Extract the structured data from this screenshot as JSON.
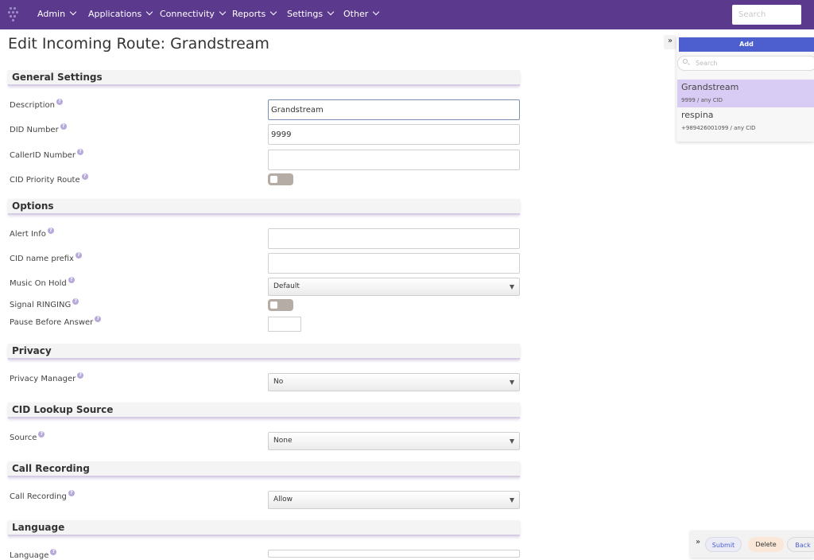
{
  "nav": {
    "items": [
      {
        "label": "Admin"
      },
      {
        "label": "Applications"
      },
      {
        "label": "Connectivity"
      },
      {
        "label": "Reports"
      },
      {
        "label": "Settings"
      },
      {
        "label": "Other"
      }
    ],
    "search_placeholder": "Search"
  },
  "page": {
    "title": "Edit Incoming Route: Grandstream"
  },
  "sections": {
    "general": {
      "title": "General Settings",
      "description_label": "Description",
      "description_value": "Grandstream",
      "did_label": "DID Number",
      "did_value": "9999",
      "callerid_label": "CallerID Number",
      "callerid_value": "",
      "cid_priority_label": "CID Priority Route",
      "cid_priority_on": false
    },
    "options": {
      "title": "Options",
      "alert_info_label": "Alert Info",
      "alert_info_value": "",
      "cid_prefix_label": "CID name prefix",
      "cid_prefix_value": "",
      "moh_label": "Music On Hold",
      "moh_value": "Default",
      "signal_ringing_label": "Signal RINGING",
      "signal_ringing_on": false,
      "pause_label": "Pause Before Answer",
      "pause_value": ""
    },
    "privacy": {
      "title": "Privacy",
      "manager_label": "Privacy Manager",
      "manager_value": "No"
    },
    "cid_lookup": {
      "title": "CID Lookup Source",
      "source_label": "Source",
      "source_value": "None"
    },
    "recording": {
      "title": "Call Recording",
      "label": "Call Recording",
      "value": "Allow"
    },
    "language": {
      "title": "Language",
      "label": "Language",
      "value": ""
    }
  },
  "help_glyph": "?",
  "sidebar": {
    "add_label": "Add",
    "search_placeholder": "Search",
    "routes": [
      {
        "name": "Grandstream",
        "sub": "9999 / any CID",
        "active": true
      },
      {
        "name": "respina",
        "sub": "+989426001099 / any CID",
        "active": false
      }
    ]
  },
  "actions": {
    "submit_label": "Submit",
    "delete_label": "Delete",
    "back_label": "Back"
  },
  "icons": {
    "expand": "double-chevron-right-icon",
    "nav_chevron": "chevron-down-icon",
    "search": "search-icon",
    "help": "help-icon"
  },
  "colors": {
    "nav_bg": "#5b3a8e",
    "accent": "#4d5fcf",
    "active_route": "#d9ccf4",
    "help": "#b7a9da"
  }
}
